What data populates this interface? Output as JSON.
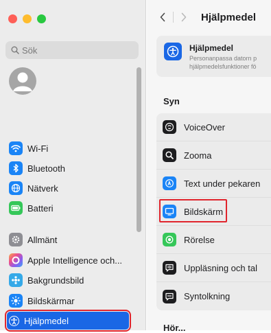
{
  "window": {
    "traffic_lights": {
      "close": "#fe5f57",
      "minimize": "#febc2e",
      "maximize": "#28c840"
    }
  },
  "sidebar": {
    "search": {
      "placeholder": "Sök"
    },
    "items": [
      {
        "label": "Wi-Fi",
        "icon": "wifi-icon",
        "color": "#1a84f6"
      },
      {
        "label": "Bluetooth",
        "icon": "bluetooth-icon",
        "color": "#1a84f6"
      },
      {
        "label": "Nätverk",
        "icon": "globe-icon",
        "color": "#1a84f6"
      },
      {
        "label": "Batteri",
        "icon": "battery-icon",
        "color": "#35c759"
      },
      {
        "label": "Allmänt",
        "icon": "gear-icon",
        "color": "#8e8e93"
      },
      {
        "label": "Apple Intelligence och...",
        "icon": "apple-intelligence-icon",
        "color": "#f0734a"
      },
      {
        "label": "Bakgrundsbild",
        "icon": "wallpaper-icon",
        "color": "#35a9e8"
      },
      {
        "label": "Bildskärmar",
        "icon": "displays-icon",
        "color": "#1a84f6"
      },
      {
        "label": "Hjälpmedel",
        "icon": "accessibility-icon",
        "color": "#1a67e5",
        "selected": true
      }
    ]
  },
  "toolbar": {
    "title": "Hjälpmedel"
  },
  "hero": {
    "title": "Hjälpmedel",
    "description_line1": "Personanpassa datorn p",
    "description_line2": "hjälpmedelsfunktioner fö"
  },
  "section": {
    "title": "Syn"
  },
  "rows": [
    {
      "label": "VoiceOver",
      "icon": "voiceover-icon",
      "color": "#1d1d1f"
    },
    {
      "label": "Zooma",
      "icon": "zoom-icon",
      "color": "#1d1d1f"
    },
    {
      "label": "Text under pekaren",
      "icon": "hover-text-icon",
      "color": "#1a84f6"
    },
    {
      "label": "Bildskärm",
      "icon": "display-icon",
      "color": "#1a84f6",
      "highlighted": true
    },
    {
      "label": "Rörelse",
      "icon": "motion-icon",
      "color": "#35c759"
    },
    {
      "label": "Uppläsning och tal",
      "icon": "spoken-content-icon",
      "color": "#1d1d1f"
    },
    {
      "label": "Syntolkning",
      "icon": "audio-description-icon",
      "color": "#1d1d1f"
    }
  ],
  "next_section": {
    "title": "Hör..."
  },
  "accent": "#1a67e5",
  "highlight_color": "#e0242c"
}
